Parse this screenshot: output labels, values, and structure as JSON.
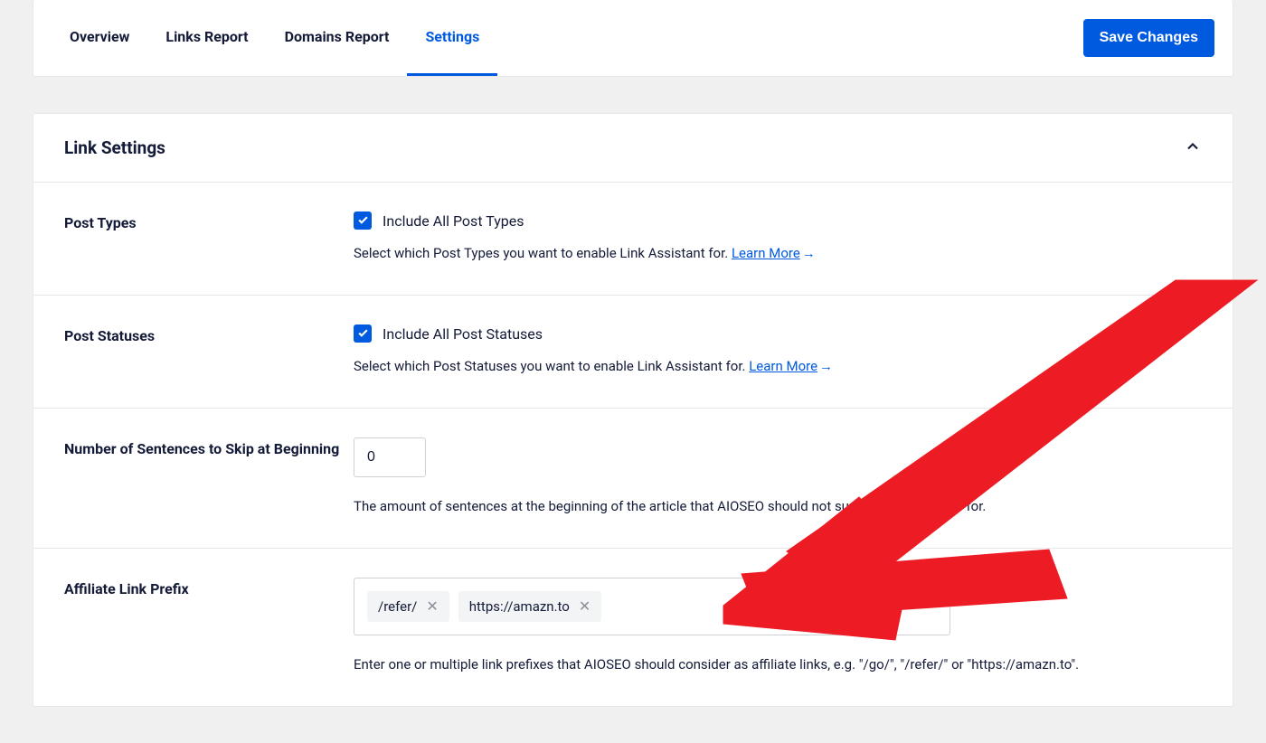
{
  "tabs": [
    {
      "label": "Overview",
      "active": false
    },
    {
      "label": "Links Report",
      "active": false
    },
    {
      "label": "Domains Report",
      "active": false
    },
    {
      "label": "Settings",
      "active": true
    }
  ],
  "save_button": "Save Changes",
  "panel": {
    "title": "Link Settings"
  },
  "post_types": {
    "label": "Post Types",
    "checkbox_label": "Include All Post Types",
    "help": "Select which Post Types you want to enable Link Assistant for. ",
    "learn_more": "Learn More"
  },
  "post_statuses": {
    "label": "Post Statuses",
    "checkbox_label": "Include All Post Statuses",
    "help": "Select which Post Statuses you want to enable Link Assistant for. ",
    "learn_more": "Learn More"
  },
  "skip_sentences": {
    "label": "Number of Sentences to Skip at Beginning",
    "value": "0",
    "help": "The amount of sentences at the beginning of the article that AIOSEO should not suggest internal links for."
  },
  "affiliate_prefix": {
    "label": "Affiliate Link Prefix",
    "tags": [
      "/refer/",
      "https://amazn.to"
    ],
    "help": "Enter one or multiple link prefixes that AIOSEO should consider as affiliate links, e.g. \"/go/\", \"/refer/\" or \"https://amazn.to\"."
  }
}
